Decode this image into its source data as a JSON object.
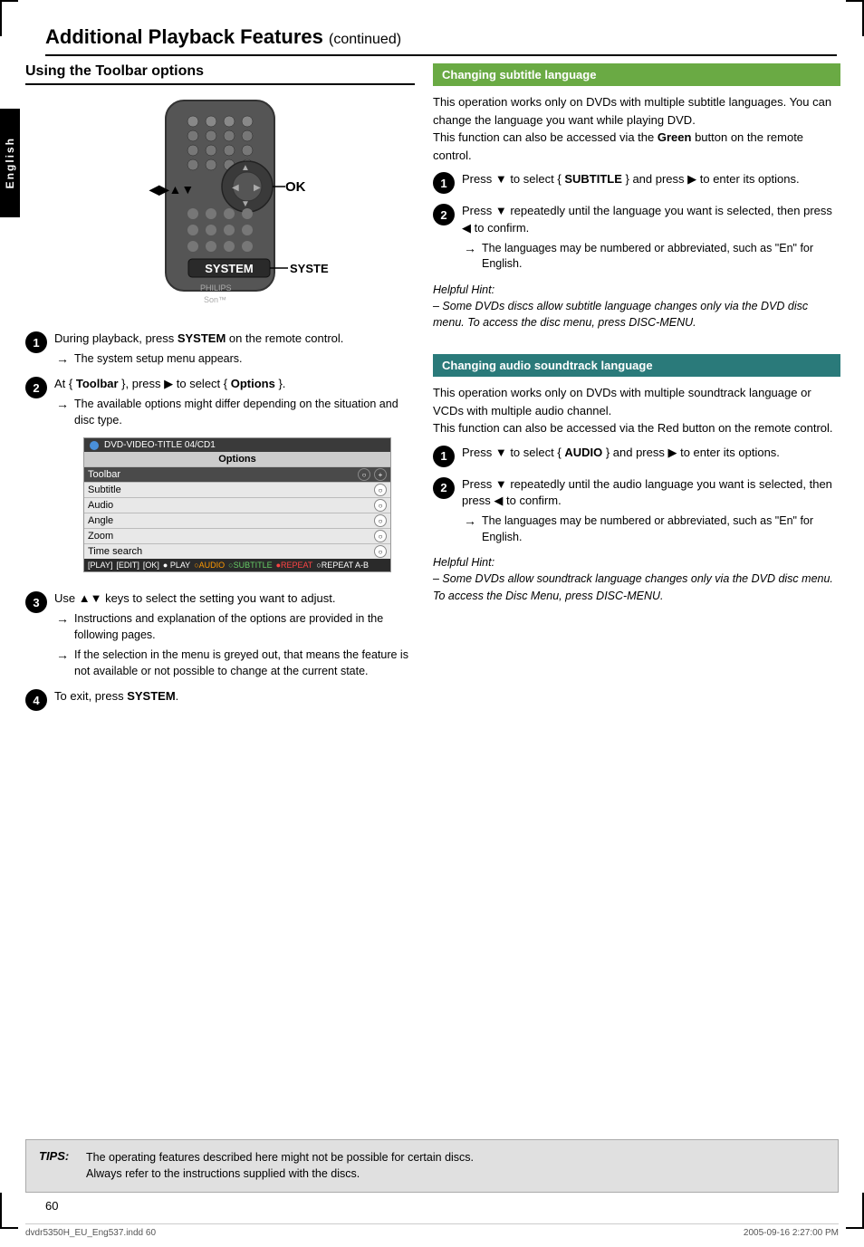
{
  "page": {
    "title": "Additional Playback Features",
    "title_suffix": "(continued)",
    "page_number": "60",
    "footer_left": "dvdr5350H_EU_Eng537.indd  60",
    "footer_right": "2005-09-16   2:27:00 PM"
  },
  "left_section": {
    "title": "Using the Toolbar options",
    "ok_label": "OK",
    "system_label": "SYSTEM",
    "steps": [
      {
        "num": "1",
        "text": "During playback, press ",
        "bold_text": "SYSTEM",
        "text2": " on the remote control.",
        "arrow": "The system setup menu appears."
      },
      {
        "num": "2",
        "text_before": "At { ",
        "bold1": "Toolbar",
        "text_mid": " }, press ",
        "arrow_sym": "▶",
        "text_after": " to select { ",
        "bold2": "Options",
        "text_end": " }.",
        "arrow": "The available options might differ depending on the situation and disc type."
      },
      {
        "num": "3",
        "text_before": "Use ",
        "arrows": "▲▼",
        "text_after": " keys to select the setting you want to adjust.",
        "arrows_list": [
          "Instructions and explanation of the options are provided in the following pages.",
          "If the selection in the menu is greyed out, that means the feature is not available or not possible to change at the current state."
        ]
      },
      {
        "num": "4",
        "text": "To exit, press ",
        "bold": "SYSTEM",
        "text2": "."
      }
    ],
    "options_table": {
      "header": "DVD-VIDEO-TITLE 04/CD1",
      "title": "Options",
      "rows": [
        {
          "label": "Toolbar",
          "icon": "○",
          "active": true,
          "plus": true
        },
        {
          "label": "Subtitle",
          "icon": "○"
        },
        {
          "label": "Audio",
          "icon": "○"
        },
        {
          "label": "Angle",
          "icon": "○"
        },
        {
          "label": "Zoom",
          "icon": "○"
        },
        {
          "label": "Time search",
          "icon": "○"
        }
      ],
      "bottom_items": [
        {
          "label": "[PLAY]",
          "color": ""
        },
        {
          "label": "[EDIT]",
          "color": ""
        },
        {
          "label": "[OK]",
          "color": ""
        },
        {
          "label": "● PLAY",
          "color": ""
        },
        {
          "label": "○ AUDIO",
          "color": "orange"
        },
        {
          "label": "○ SUBTITLE",
          "color": "green"
        },
        {
          "label": "● REPEAT",
          "color": "red"
        },
        {
          "label": "○ REPEAT A-B",
          "color": ""
        }
      ]
    }
  },
  "right_section": {
    "subtitle_section": {
      "header": "Changing subtitle language",
      "intro": "This operation works only on DVDs with multiple subtitle languages. You can change the language you want while playing DVD.",
      "intro2": "This function can also be accessed via the",
      "intro2_bold": "Green",
      "intro2_end": "button on the remote control.",
      "steps": [
        {
          "num": "1",
          "text": "Press ▼ to select { ",
          "bold": "SUBTITLE",
          "text2": " } and press ▶ to enter its options."
        },
        {
          "num": "2",
          "text": "Press ▼ repeatedly until the language you want is selected, then press ◀ to confirm.",
          "arrow": "The languages may be numbered or abbreviated, such as \"En\" for English."
        }
      ],
      "helpful_hint": "Helpful Hint:",
      "hint_text": "– Some DVDs discs allow subtitle language changes only via the DVD disc menu. To access the disc menu, press DISC-MENU."
    },
    "audio_section": {
      "header": "Changing audio soundtrack language",
      "intro": "This operation works only on DVDs with multiple soundtrack language or VCDs with multiple audio channel.",
      "intro2": "This function can also be accessed via the Red button on the remote control.",
      "steps": [
        {
          "num": "1",
          "text": "Press ▼ to select { ",
          "bold": "AUDIO",
          "text2": " } and press ▶ to enter its options."
        },
        {
          "num": "2",
          "text": "Press ▼ repeatedly until the audio language you want is selected, then press ◀ to confirm.",
          "arrow": "The languages may be numbered or abbreviated, such as \"En\" for English."
        }
      ],
      "helpful_hint": "Helpful Hint:",
      "hint_text": "– Some DVDs allow soundtrack language changes only via the DVD disc menu. To access the Disc Menu, press DISC-MENU."
    }
  },
  "tip_box": {
    "label": "TIPS:",
    "line1": "The operating features described here might not be possible for certain discs.",
    "line2": "Always refer to the instructions supplied with the discs."
  }
}
